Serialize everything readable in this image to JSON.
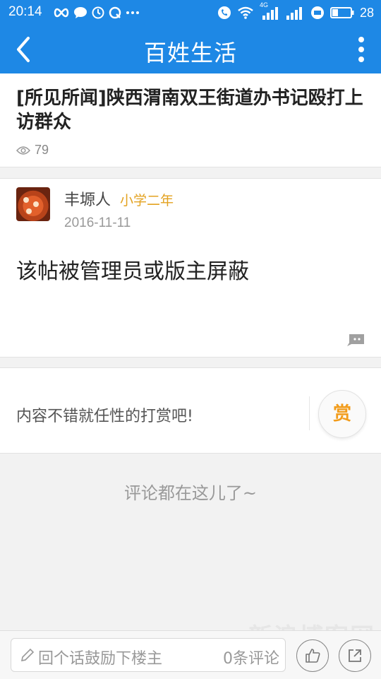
{
  "status_bar": {
    "time": "20:14",
    "signal_label": "4G",
    "battery": "28"
  },
  "header": {
    "title": "百姓生活",
    "back_icon": "chevron-left-icon",
    "menu_icon": "more-vertical-icon"
  },
  "post": {
    "title": "[所见所闻]陕西渭南双王街道办书记殴打上访群众",
    "views": "79",
    "author": {
      "name": "丰塬人",
      "level": "小学二年"
    },
    "date": "2016-11-11",
    "content": "该帖被管理员或版主屏蔽"
  },
  "reward": {
    "text": "内容不错就任性的打赏吧!",
    "button_label": "赏"
  },
  "comments": {
    "empty_text": "评论都在这儿了~"
  },
  "bottom_bar": {
    "input_placeholder": "回个话鼓励下楼主",
    "comment_count_label": "0条评论"
  },
  "colors": {
    "primary": "#1e88e5",
    "accent": "#f29c1b",
    "level": "#e3a220"
  }
}
